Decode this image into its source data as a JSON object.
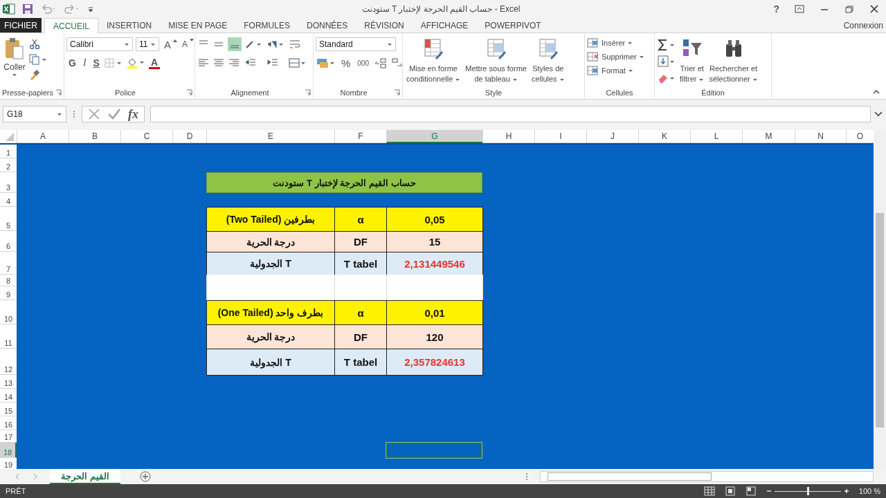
{
  "window": {
    "title": "ستودنت T حساب القيم الحرجة لإختبار - Excel",
    "help": "?"
  },
  "ribbon_tabs": [
    {
      "label": "FICHIER",
      "kind": "file",
      "selected": false
    },
    {
      "label": "ACCUEIL",
      "kind": "tab",
      "selected": true
    },
    {
      "label": "INSERTION",
      "kind": "tab",
      "selected": false
    },
    {
      "label": "MISE EN PAGE",
      "kind": "tab",
      "selected": false
    },
    {
      "label": "FORMULES",
      "kind": "tab",
      "selected": false
    },
    {
      "label": "DONNÉES",
      "kind": "tab",
      "selected": false
    },
    {
      "label": "RÉVISION",
      "kind": "tab",
      "selected": false
    },
    {
      "label": "AFFICHAGE",
      "kind": "tab",
      "selected": false
    },
    {
      "label": "POWERPIVOT",
      "kind": "tab",
      "selected": false
    }
  ],
  "account": "Connexion",
  "ribbon": {
    "groups": [
      {
        "label": "Presse-papiers",
        "kind": "clipboard",
        "paste": "Coller"
      },
      {
        "label": "Police",
        "kind": "font",
        "font": "Calibri",
        "size": "11",
        "grow": "A",
        "shrink": "A",
        "bold": "G",
        "italic": "I",
        "underline": "S",
        "font_color": "A"
      },
      {
        "label": "Alignement",
        "kind": "alignment"
      },
      {
        "label": "Nombre",
        "kind": "number",
        "format": "Standard",
        "percent": "%",
        "thousands": "000"
      },
      {
        "label": "Style",
        "kind": "style",
        "buttons": [
          [
            "Mise en forme",
            "conditionnelle"
          ],
          [
            "Mettre sous forme",
            "de tableau"
          ],
          [
            "Styles de",
            "cellules"
          ]
        ]
      },
      {
        "label": "Cellules",
        "kind": "cells",
        "buttons": [
          "Insérer",
          "Supprimer",
          "Format"
        ]
      },
      {
        "label": "Édition",
        "kind": "editing",
        "buttons": [
          [
            "Trier et",
            "filtrer"
          ],
          [
            "Rechercher et",
            "sélectionner"
          ]
        ]
      }
    ]
  },
  "formula_bar": {
    "name_box": "G18",
    "fx": "fx"
  },
  "columns": [
    {
      "label": "A",
      "selected": false
    },
    {
      "label": "B",
      "selected": false
    },
    {
      "label": "C",
      "selected": false
    },
    {
      "label": "D",
      "selected": false
    },
    {
      "label": "E",
      "selected": false
    },
    {
      "label": "F",
      "selected": false
    },
    {
      "label": "G",
      "selected": true
    },
    {
      "label": "H",
      "selected": false
    },
    {
      "label": "I",
      "selected": false
    },
    {
      "label": "J",
      "selected": false
    },
    {
      "label": "K",
      "selected": false
    },
    {
      "label": "L",
      "selected": false
    },
    {
      "label": "M",
      "selected": false
    },
    {
      "label": "N",
      "selected": false
    },
    {
      "label": "O",
      "selected": false
    }
  ],
  "rows": [
    {
      "label": "1",
      "selected": false
    },
    {
      "label": "2",
      "selected": false
    },
    {
      "label": "3",
      "selected": false
    },
    {
      "label": "4",
      "selected": false
    },
    {
      "label": "5",
      "selected": false
    },
    {
      "label": "6",
      "selected": false
    },
    {
      "label": "7",
      "selected": false
    },
    {
      "label": "8",
      "selected": false
    },
    {
      "label": "9",
      "selected": false
    },
    {
      "label": "10",
      "selected": false
    },
    {
      "label": "11",
      "selected": false
    },
    {
      "label": "12",
      "selected": false
    },
    {
      "label": "13",
      "selected": false
    },
    {
      "label": "14",
      "selected": false
    },
    {
      "label": "15",
      "selected": false
    },
    {
      "label": "16",
      "selected": false
    },
    {
      "label": "17",
      "selected": false
    },
    {
      "label": "18",
      "selected": true
    },
    {
      "label": "19",
      "selected": false
    }
  ],
  "table": {
    "title": "حساب القيم الحرجة لإختبار T ستودنت",
    "rows": [
      {
        "kind": "alpha",
        "cells": [
          "بطرفين (Two Tailed)",
          "α",
          "0,05"
        ]
      },
      {
        "kind": "df",
        "cells": [
          "درجة الحرية",
          "DF",
          "15"
        ]
      },
      {
        "kind": "t",
        "cells": [
          "T الجدولية",
          "T tabel",
          "2,131449546"
        ]
      },
      {
        "kind": "blank"
      },
      {
        "kind": "blank"
      },
      {
        "kind": "alpha",
        "cells": [
          "بطرف واحد (One Tailed)",
          "α",
          "0,01"
        ]
      },
      {
        "kind": "df",
        "cells": [
          "درجة الحرية",
          "DF",
          "120"
        ]
      },
      {
        "kind": "t",
        "cells": [
          "T الجدولية",
          "T tabel",
          "2,357824613"
        ]
      }
    ]
  },
  "sheet_tabs": [
    {
      "label": "القيم الحرجة",
      "selected": true
    }
  ],
  "status_bar": {
    "status": "PRÊT",
    "zoom_slider": {
      "level": 0.5
    },
    "zoom": "100 %"
  }
}
